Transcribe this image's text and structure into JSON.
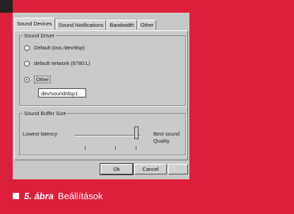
{
  "tabs": [
    "Sound Devices",
    "Sound Notifications",
    "Bandwidth",
    "Other"
  ],
  "sound_driver": {
    "legend": "Sound Driver",
    "options": [
      "Default  (oss /dev/dsp)",
      "default network (8780:L)",
      "Other"
    ],
    "selected": "Other",
    "other_value": "dev/sound/dsp1"
  },
  "buffer": {
    "legend": "Sound Buffer Size",
    "low_label": "Lowest latency",
    "high_label": "Best sound Quality",
    "level": 0.95
  },
  "buttons": {
    "ok": "Ok",
    "cancel": "Cancel"
  },
  "caption": {
    "number": "5. ábra",
    "title": "Beállítások"
  },
  "colors": {
    "page_bg": "#dc1f3b",
    "window_bg": "#c8c8c8"
  }
}
